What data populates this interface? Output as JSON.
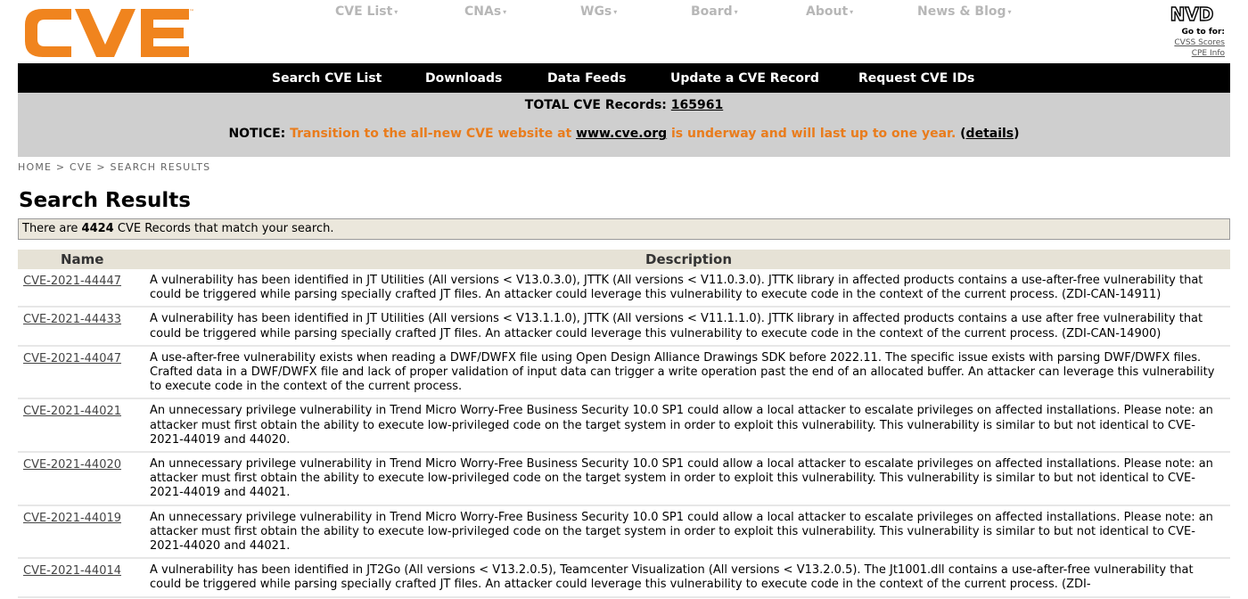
{
  "top_nav": {
    "items": [
      {
        "label": "CVE List"
      },
      {
        "label": "CNAs"
      },
      {
        "label": "WGs"
      },
      {
        "label": "Board"
      },
      {
        "label": "About"
      },
      {
        "label": "News & Blog"
      }
    ],
    "caret": "▾"
  },
  "nvd": {
    "logo_text": "NVD",
    "go_to": "Go to for:",
    "links": [
      "CVSS Scores",
      "CPE Info"
    ]
  },
  "black_bar": {
    "items": [
      "Search CVE List",
      "Downloads",
      "Data Feeds",
      "Update a CVE Record",
      "Request CVE IDs"
    ]
  },
  "stats": {
    "total_label": "TOTAL CVE Records:",
    "total_value": "165961"
  },
  "notice": {
    "label": "NOTICE:",
    "text_a": "Transition to the all-new CVE website at",
    "link": "www.cve.org",
    "text_b": "is underway and will last up to one year.",
    "details_open": "(",
    "details": "details",
    "details_close": ")"
  },
  "breadcrumb": "HOME > CVE > SEARCH RESULTS",
  "page_title": "Search Results",
  "match": {
    "prefix": "There are",
    "count": "4424",
    "suffix": "CVE Records that match your search."
  },
  "table": {
    "headers": [
      "Name",
      "Description"
    ],
    "rows": [
      {
        "id": "CVE-2021-44447",
        "desc": "A vulnerability has been identified in JT Utilities (All versions < V13.0.3.0), JTTK (All versions < V11.0.3.0). JTTK library in affected products contains a use-after-free vulnerability that could be triggered while parsing specially crafted JT files. An attacker could leverage this vulnerability to execute code in the context of the current process. (ZDI-CAN-14911)"
      },
      {
        "id": "CVE-2021-44433",
        "desc": "A vulnerability has been identified in JT Utilities (All versions < V13.1.1.0), JTTK (All versions < V11.1.1.0). JTTK library in affected products contains a use after free vulnerability that could be triggered while parsing specially crafted JT files. An attacker could leverage this vulnerability to execute code in the context of the current process. (ZDI-CAN-14900)"
      },
      {
        "id": "CVE-2021-44047",
        "desc": "A use-after-free vulnerability exists when reading a DWF/DWFX file using Open Design Alliance Drawings SDK before 2022.11. The specific issue exists with parsing DWF/DWFX files. Crafted data in a DWF/DWFX file and lack of proper validation of input data can trigger a write operation past the end of an allocated buffer. An attacker can leverage this vulnerability to execute code in the context of the current process."
      },
      {
        "id": "CVE-2021-44021",
        "desc": "An unnecessary privilege vulnerability in Trend Micro Worry-Free Business Security 10.0 SP1 could allow a local attacker to escalate privileges on affected installations. Please note: an attacker must first obtain the ability to execute low-privileged code on the target system in order to exploit this vulnerability. This vulnerability is similar to but not identical to CVE-2021-44019 and 44020."
      },
      {
        "id": "CVE-2021-44020",
        "desc": "An unnecessary privilege vulnerability in Trend Micro Worry-Free Business Security 10.0 SP1 could allow a local attacker to escalate privileges on affected installations. Please note: an attacker must first obtain the ability to execute low-privileged code on the target system in order to exploit this vulnerability. This vulnerability is similar to but not identical to CVE-2021-44019 and 44021."
      },
      {
        "id": "CVE-2021-44019",
        "desc": "An unnecessary privilege vulnerability in Trend Micro Worry-Free Business Security 10.0 SP1 could allow a local attacker to escalate privileges on affected installations. Please note: an attacker must first obtain the ability to execute low-privileged code on the target system in order to exploit this vulnerability. This vulnerability is similar to but not identical to CVE-2021-44020 and 44021."
      },
      {
        "id": "CVE-2021-44014",
        "desc": "A vulnerability has been identified in JT2Go (All versions < V13.2.0.5), Teamcenter Visualization (All versions < V13.2.0.5). The Jt1001.dll contains a use-after-free vulnerability that could be triggered while parsing specially crafted JT files. An attacker could leverage this vulnerability to execute code in the context of the current process. (ZDI-"
      }
    ]
  },
  "colors": {
    "brand_orange": "#f0841e",
    "notice_orange": "#e97c1c",
    "nav_grey": "#b7b7b7",
    "black_bar": "#000000",
    "grey_band": "#cfcfcf",
    "table_header_bg": "#e6e2d6"
  }
}
